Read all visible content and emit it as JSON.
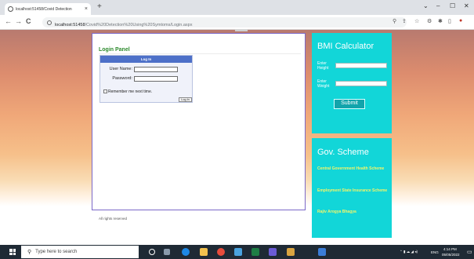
{
  "browser": {
    "tab_title": "localhost:51458/Covid Detection",
    "tab_close": "×",
    "new_tab": "+",
    "url_host": "localhost:51458",
    "url_path": "/Covid%20Detection%20Using%20Symtoms/Login.aspx",
    "back": "←",
    "forward": "→",
    "reload": "C",
    "minimize": "–",
    "maximize": "☐",
    "close": "✕"
  },
  "login": {
    "panel_title": "Login Panel",
    "header": "Log In",
    "username_label": "User Name:",
    "username_value": "",
    "password_label": "Password:",
    "password_value": "",
    "remember_label": "Remember me next time.",
    "login_button": "Log In"
  },
  "footer": "All rights reserved",
  "bmi": {
    "title": "BMI Calculator",
    "height_label": "Enter Height",
    "height_value": "",
    "weight_label": "Enter Weight",
    "weight_value": "",
    "submit": "Submit"
  },
  "gov": {
    "title": "Gov. Scheme",
    "links": [
      "Central Government Health Scheme",
      "Employment State Insurance Scheme",
      "Rajiv Arogya Bhagya"
    ]
  },
  "taskbar": {
    "search_placeholder": "Type here to search",
    "lang": "ENG",
    "time": "4:14 PM",
    "date": "05/05/2022"
  },
  "colors": {
    "accent_cyan": "#12d6d8",
    "link_yellow": "#f3f56a",
    "login_header": "#4d70c8",
    "panel_title_green": "#2e8b2e"
  }
}
